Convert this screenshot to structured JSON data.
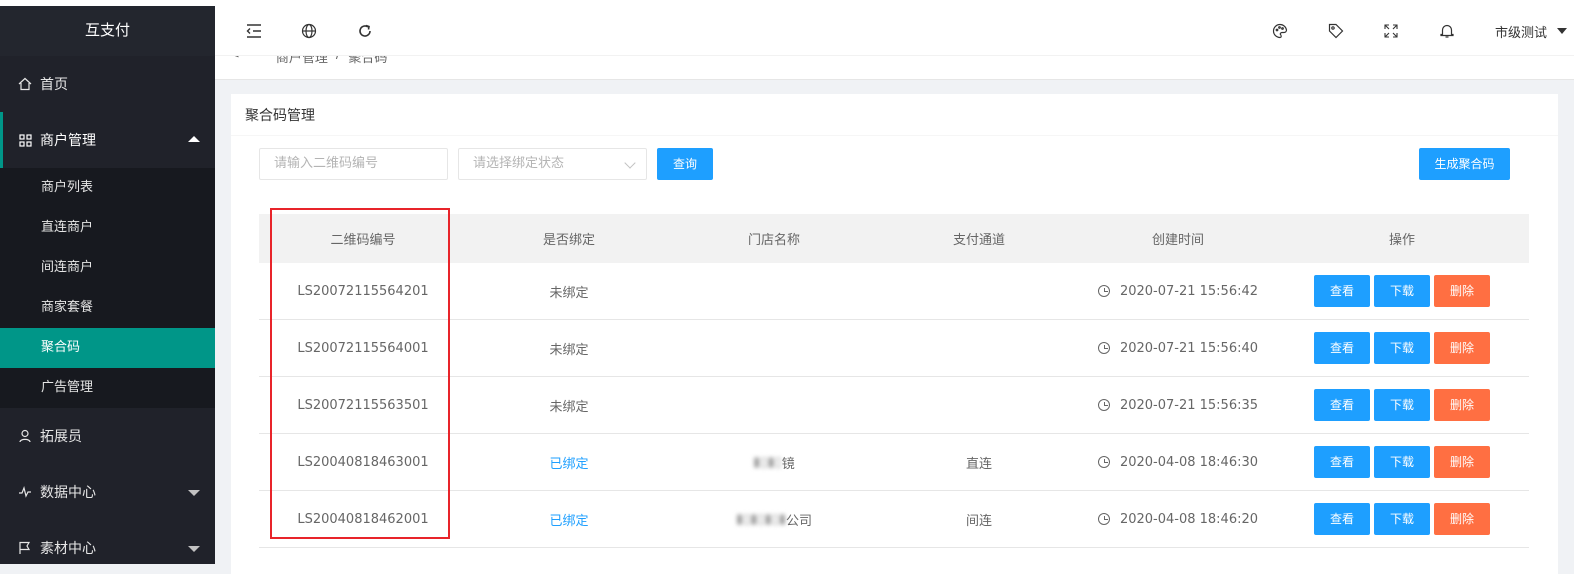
{
  "app": {
    "title": "互支付"
  },
  "sidebar": {
    "items": [
      {
        "label": "首页",
        "icon": "home-icon"
      },
      {
        "label": "商户管理",
        "icon": "grid-icon",
        "expanded": true,
        "children": [
          "商户列表",
          "直连商户",
          "间连商户",
          "商家套餐",
          "聚合码",
          "广告管理"
        ]
      },
      {
        "label": "拓展员",
        "icon": "user-icon"
      },
      {
        "label": "数据中心",
        "icon": "activity-icon"
      },
      {
        "label": "素材中心",
        "icon": "flag-icon"
      }
    ],
    "selected": "聚合码"
  },
  "header": {
    "icons": [
      "menu-fold-icon",
      "globe-icon",
      "refresh-icon",
      "palette-icon",
      "tag-icon",
      "fullscreen-icon",
      "bell-icon"
    ],
    "user": "市级测试"
  },
  "breadcrumb": [
    "商户管理",
    "/",
    "聚合码"
  ],
  "card": {
    "title": "聚合码管理",
    "search_placeholder": "请输入二维码编号",
    "status_placeholder": "请选择绑定状态",
    "query_label": "查询",
    "generate_label": "生成聚合码"
  },
  "table": {
    "columns": [
      "二维码编号",
      "是否绑定",
      "门店名称",
      "支付通道",
      "创建时间",
      "操作"
    ],
    "rows": [
      {
        "code": "LS20072115564201",
        "bound": "未绑定",
        "store": "",
        "channel": "",
        "created": "2020-07-21 15:56:42"
      },
      {
        "code": "LS20072115564001",
        "bound": "未绑定",
        "store": "",
        "channel": "",
        "created": "2020-07-21 15:56:40"
      },
      {
        "code": "LS20072115563501",
        "bound": "未绑定",
        "store": "",
        "channel": "",
        "created": "2020-07-21 15:56:35"
      },
      {
        "code": "LS20040818463001",
        "bound": "已绑定",
        "store": "镜",
        "channel": "直连",
        "created": "2020-04-08 18:46:30"
      },
      {
        "code": "LS20040818462001",
        "bound": "已绑定",
        "store": "公司",
        "channel": "间连",
        "created": "2020-04-08 18:46:20"
      }
    ],
    "actions": {
      "view": "查看",
      "download": "下载",
      "delete": "删除"
    }
  },
  "colors": {
    "sidebar_bg": "#20222a",
    "accent": "#009688",
    "primary": "#1e9fff",
    "danger": "#ff5722",
    "highlight": "#e8242a"
  }
}
